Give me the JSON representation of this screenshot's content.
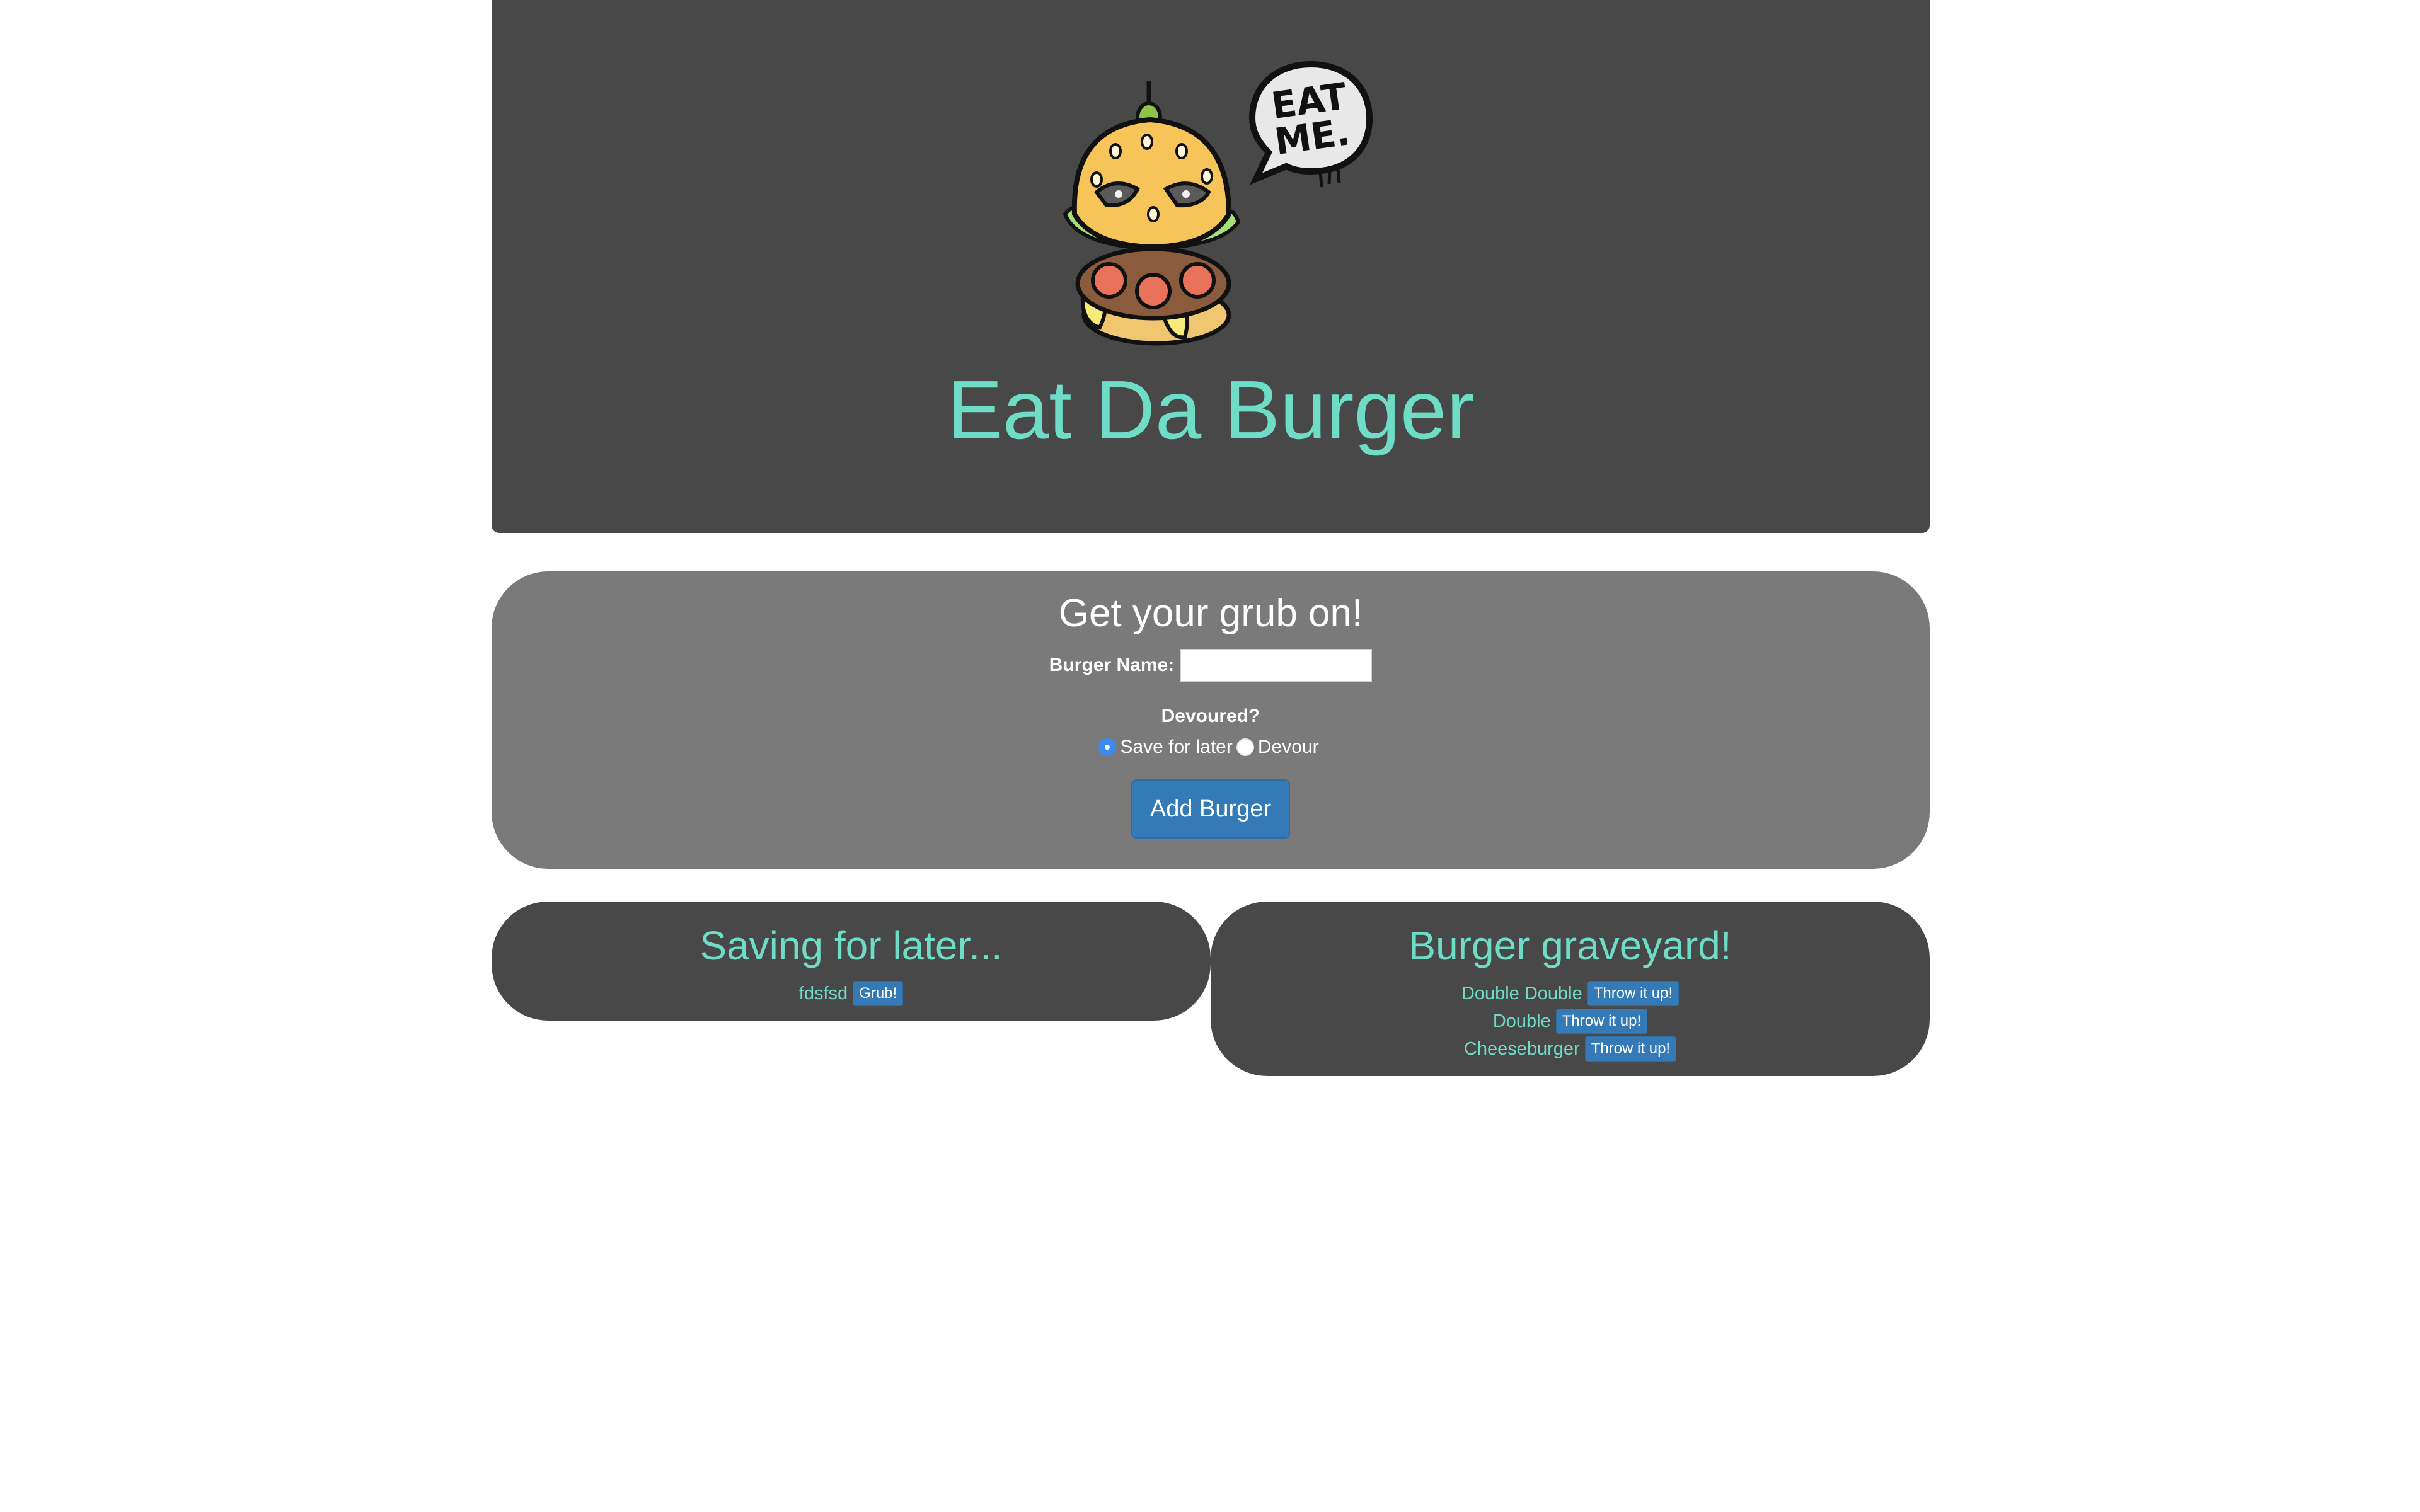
{
  "header": {
    "title": "Eat Da Burger",
    "logo_bubble_text": "EAT ME."
  },
  "form": {
    "title": "Get your grub on!",
    "name_label": "Burger Name:",
    "name_value": "",
    "name_placeholder": "",
    "devoured_label": "Devoured?",
    "options": {
      "save": "Save for later",
      "devour": "Devour"
    },
    "selected_option": "Save for later",
    "submit_label": "Add Burger"
  },
  "saving": {
    "title": "Saving for later...",
    "items": [
      {
        "name": "fdsfsd",
        "button": "Grub!"
      }
    ]
  },
  "graveyard": {
    "title": "Burger graveyard!",
    "items": [
      {
        "name": "Double Double",
        "button": "Throw it up!"
      },
      {
        "name": "Double",
        "button": "Throw it up!"
      },
      {
        "name": "Cheeseburger",
        "button": "Throw it up!"
      }
    ]
  },
  "colors": {
    "header_bg": "#484848",
    "form_bg": "#7a7a7a",
    "accent_text": "#6fdcc6",
    "button_bg": "#337ab7"
  }
}
